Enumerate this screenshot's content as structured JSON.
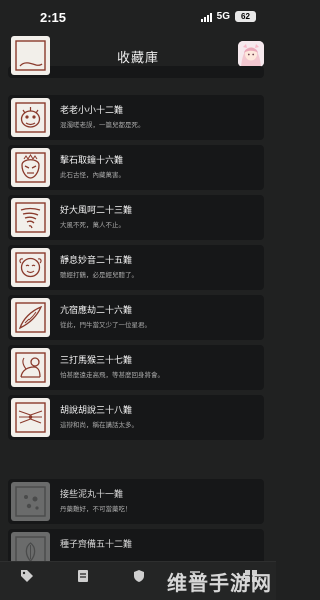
{
  "status": {
    "time": "2:15",
    "network": "5G",
    "battery": "62"
  },
  "nav": {
    "title": "收藏庫"
  },
  "cards": [
    {
      "title": "",
      "desc": "",
      "icon": "partial-ink-icon",
      "locked": false
    },
    {
      "title": "老老小小十二難",
      "desc": "混濁嗟老誤，一篇兒都是死。",
      "icon": "creature-ink-icon",
      "locked": false
    },
    {
      "title": "擊石取鑰十六難",
      "desc": "此石古怪，內藏萬害。",
      "icon": "mask-ink-icon",
      "locked": false
    },
    {
      "title": "好大風呵二十三難",
      "desc": "大風不死，萬人不止。",
      "icon": "whirlwind-ink-icon",
      "locked": false
    },
    {
      "title": "靜息妙音二十五難",
      "desc": "聽經打鶴，必是經兒聽了。",
      "icon": "face-ink-icon",
      "locked": false
    },
    {
      "title": "亢宿應劫二十六難",
      "desc": "從此，門牛當又少了一位星君。",
      "icon": "horn-ink-icon",
      "locked": false
    },
    {
      "title": "三打馬猴三十七難",
      "desc": "怕甚麼遠走高飛，等甚麼回身將會。",
      "icon": "monkey-ink-icon",
      "locked": false
    },
    {
      "title": "胡說胡說三十八難",
      "desc": "這辯和尚，稱在講話太多。",
      "icon": "whiskers-ink-icon",
      "locked": false
    },
    {
      "title": "接些泥丸十一難",
      "desc": "丹藥難好，不可當藥吃！",
      "icon": "pellet-ink-icon",
      "locked": true
    },
    {
      "title": "種子齊備五十二難",
      "desc": "",
      "icon": "seed-ink-icon",
      "locked": true
    }
  ],
  "watermark": "维普手游网",
  "tabs": [
    "tag-icon",
    "document-icon",
    "shield-icon",
    "lines-icon",
    "grid-icon"
  ]
}
